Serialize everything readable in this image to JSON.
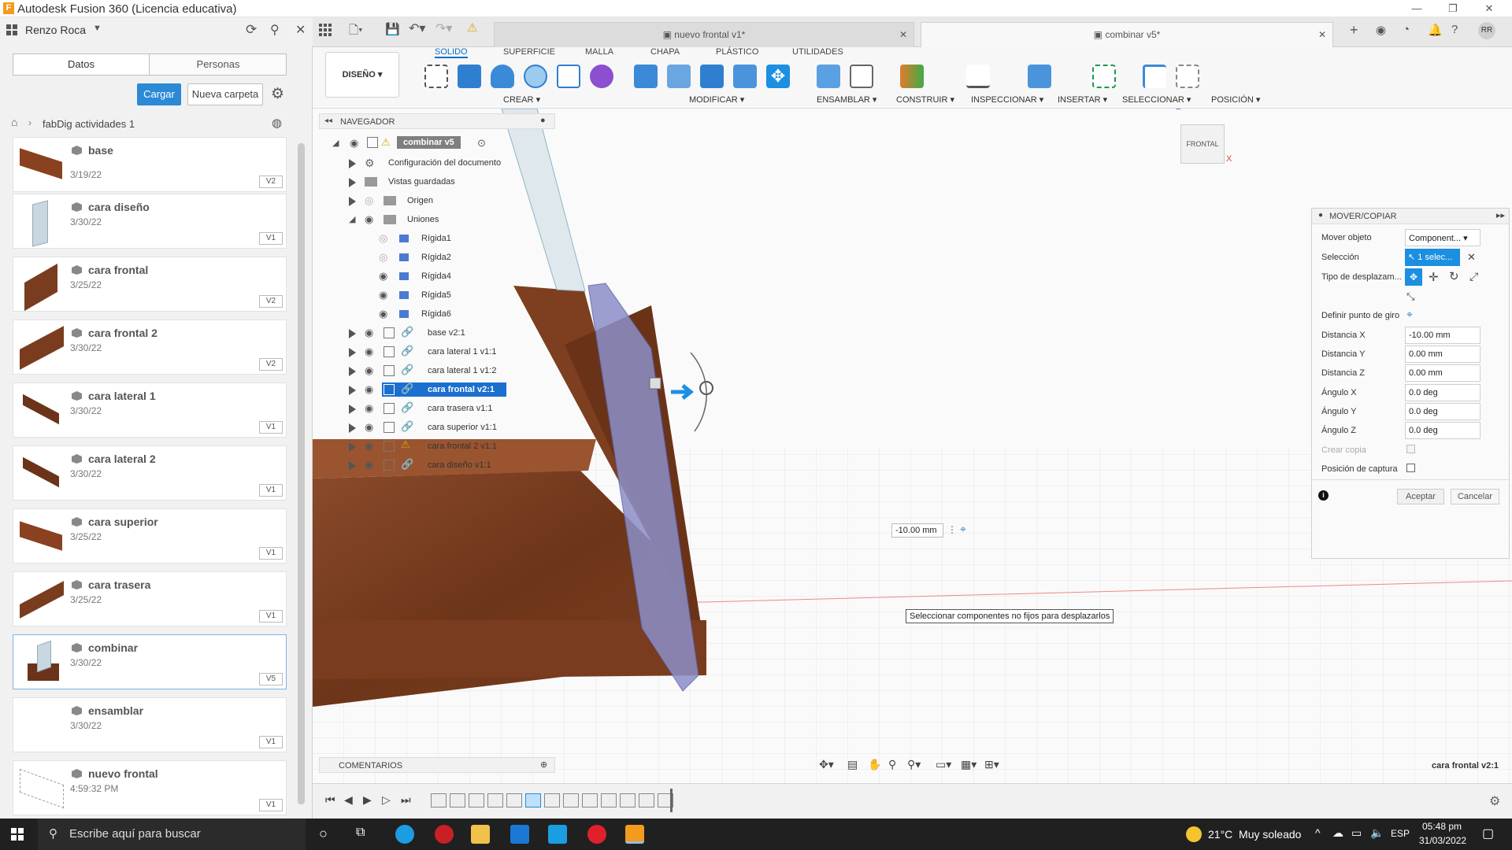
{
  "window": {
    "title": "Autodesk Fusion 360 (Licencia educativa)",
    "logo": "F"
  },
  "user": {
    "name": "Renzo Roca"
  },
  "data_panel": {
    "tabs": [
      "Datos",
      "Personas"
    ],
    "load_button": "Cargar",
    "new_folder_button": "Nueva carpeta",
    "breadcrumb": "fabDig actividades 1",
    "items": [
      {
        "name": "base",
        "date": "3/19/22",
        "version": "V2"
      },
      {
        "name": "cara diseño",
        "date": "3/30/22",
        "version": "V1"
      },
      {
        "name": "cara frontal",
        "date": "3/25/22",
        "version": "V2"
      },
      {
        "name": "cara frontal 2",
        "date": "3/30/22",
        "version": "V2"
      },
      {
        "name": "cara lateral 1",
        "date": "3/30/22",
        "version": "V1"
      },
      {
        "name": "cara lateral 2",
        "date": "3/30/22",
        "version": "V1"
      },
      {
        "name": "cara superior",
        "date": "3/25/22",
        "version": "V1"
      },
      {
        "name": "cara trasera",
        "date": "3/25/22",
        "version": "V1"
      },
      {
        "name": "combinar",
        "date": "3/30/22",
        "version": "V5"
      },
      {
        "name": "ensamblar",
        "date": "3/30/22",
        "version": "V1"
      },
      {
        "name": "nuevo frontal",
        "date": "4:59:32 PM",
        "version": "V1"
      }
    ]
  },
  "doc_tabs": [
    {
      "label": "nuevo frontal v1*",
      "active": false
    },
    {
      "label": "combinar v5*",
      "active": true
    }
  ],
  "avatar": "RR",
  "toolbar": {
    "workspace": "DISEÑO",
    "tabs": [
      "SOLIDO",
      "SUPERFICIE",
      "MALLA",
      "CHAPA",
      "PLÁSTICO",
      "UTILIDADES"
    ],
    "active_tab": "SOLIDO",
    "groups": [
      "CREAR",
      "MODIFICAR",
      "ENSAMBLAR",
      "CONSTRUIR",
      "INSPECCIONAR",
      "INSERTAR",
      "SELECCIONAR",
      "POSICIÓN"
    ]
  },
  "navigator": {
    "title": "NAVEGADOR",
    "root": "combinar v5",
    "rows": [
      {
        "label": "Configuración del documento",
        "indent": 1
      },
      {
        "label": "Vistas guardadas",
        "indent": 1
      },
      {
        "label": "Origen",
        "indent": 1
      },
      {
        "label": "Uniones",
        "indent": 1
      },
      {
        "label": "Rígida1",
        "indent": 2
      },
      {
        "label": "Rígida2",
        "indent": 2
      },
      {
        "label": "Rígida4",
        "indent": 2
      },
      {
        "label": "Rígida5",
        "indent": 2
      },
      {
        "label": "Rígida6",
        "indent": 2
      },
      {
        "label": "base v2:1",
        "indent": 1
      },
      {
        "label": "cara lateral 1 v1:1",
        "indent": 1
      },
      {
        "label": "cara lateral 1 v1:2",
        "indent": 1
      },
      {
        "label": "cara frontal v2:1",
        "indent": 1,
        "selected": true
      },
      {
        "label": "cara trasera v1:1",
        "indent": 1
      },
      {
        "label": "cara superior v1:1",
        "indent": 1
      },
      {
        "label": "cara frontal 2 v1:1",
        "indent": 1
      },
      {
        "label": "cara diseño v1:1",
        "indent": 1
      }
    ]
  },
  "viewcube": {
    "label": "FRONTAL",
    "z": "Z",
    "x": "X"
  },
  "move_panel": {
    "title": "MOVER/COPIAR",
    "move_object_label": "Mover objeto",
    "move_object_value": "Component...",
    "selection_label": "Selección",
    "selection_value": "1 selec...",
    "move_type_label": "Tipo de desplazam...",
    "pivot_label": "Definir punto de giro",
    "fields": [
      {
        "label": "Distancia X",
        "value": "-10.00 mm"
      },
      {
        "label": "Distancia Y",
        "value": "0.00 mm"
      },
      {
        "label": "Distancia Z",
        "value": "0.00 mm"
      },
      {
        "label": "Ángulo X",
        "value": "0.0 deg"
      },
      {
        "label": "Ángulo Y",
        "value": "0.0 deg"
      },
      {
        "label": "Ángulo Z",
        "value": "0.0 deg"
      }
    ],
    "create_copy_label": "Crear copia",
    "capture_label": "Posición de captura",
    "accept": "Aceptar",
    "cancel": "Cancelar"
  },
  "viewport": {
    "input_value": "-10.00 mm",
    "tooltip": "Seleccionar componentes no fijos para desplazarlos",
    "comments": "COMENTARIOS",
    "status": "cara frontal v2:1"
  },
  "taskbar": {
    "search_placeholder": "Escribe aquí para buscar",
    "weather": "21°C  Muy soleado",
    "lang": "ESP",
    "time": "05:48 pm",
    "date": "31/03/2022"
  },
  "colors": {
    "accent": "#0a6fc5",
    "wood": "#7a3c1f",
    "selected_part": "#8c8fc8"
  }
}
